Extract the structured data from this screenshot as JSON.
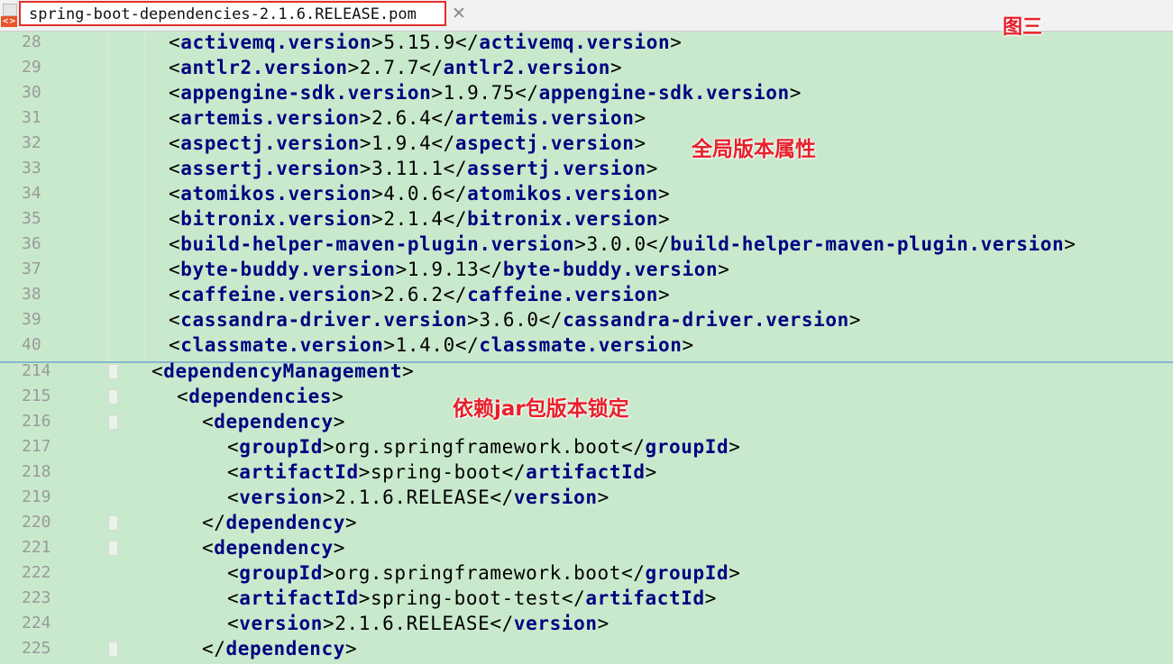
{
  "tab": {
    "title": "spring-boot-dependencies-2.1.6.RELEASE.pom",
    "close": "✕",
    "file_icon": "<>"
  },
  "annotations": {
    "figure": "图三",
    "global_props": "全局版本属性",
    "dep_lock": "依赖jar包版本锁定"
  },
  "properties": [
    {
      "line": "28",
      "name": "activemq.version",
      "value": "5.15.9"
    },
    {
      "line": "29",
      "name": "antlr2.version",
      "value": "2.7.7"
    },
    {
      "line": "30",
      "name": "appengine-sdk.version",
      "value": "1.9.75"
    },
    {
      "line": "31",
      "name": "artemis.version",
      "value": "2.6.4"
    },
    {
      "line": "32",
      "name": "aspectj.version",
      "value": "1.9.4"
    },
    {
      "line": "33",
      "name": "assertj.version",
      "value": "3.11.1"
    },
    {
      "line": "34",
      "name": "atomikos.version",
      "value": "4.0.6"
    },
    {
      "line": "35",
      "name": "bitronix.version",
      "value": "2.1.4"
    },
    {
      "line": "36",
      "name": "build-helper-maven-plugin.version",
      "value": "3.0.0"
    },
    {
      "line": "37",
      "name": "byte-buddy.version",
      "value": "1.9.13"
    },
    {
      "line": "38",
      "name": "caffeine.version",
      "value": "2.6.2"
    },
    {
      "line": "39",
      "name": "cassandra-driver.version",
      "value": "3.6.0"
    },
    {
      "line": "40",
      "name": "classmate.version",
      "value": "1.4.0"
    }
  ],
  "lines": {
    "l214": "214",
    "l215": "215",
    "l216": "216",
    "l217": "217",
    "l218": "218",
    "l219": "219",
    "l220": "220",
    "l221": "221",
    "l222": "222",
    "l223": "223",
    "l224": "224",
    "l225": "225"
  },
  "dm": {
    "dependencyManagement": "dependencyManagement",
    "dependencies": "dependencies",
    "dependency": "dependency",
    "groupId": "groupId",
    "artifactId": "artifactId",
    "version": "version",
    "dep1": {
      "groupId": "org.springframework.boot",
      "artifactId": "spring-boot",
      "version": "2.1.6.RELEASE"
    },
    "dep2": {
      "groupId": "org.springframework.boot",
      "artifactId": "spring-boot-test",
      "version": "2.1.6.RELEASE"
    }
  }
}
